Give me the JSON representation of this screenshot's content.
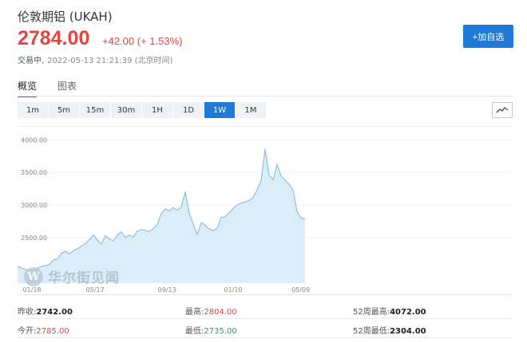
{
  "header": {
    "title": "伦敦期铝  (UKAH)",
    "price": "2784.00",
    "change": "+42.00  (+ 1.53%)",
    "status": "交易中,",
    "timestamp": "2022-05-13 21:21:39 (北京时间)",
    "add_button": "+加自选"
  },
  "tabs": [
    {
      "label": "概览"
    },
    {
      "label": "图表"
    }
  ],
  "periods": [
    "1m",
    "5m",
    "15m",
    "30m",
    "1H",
    "1D",
    "1W",
    "1M"
  ],
  "active_period": "1W",
  "colors": {
    "accent": "#1e7ad6",
    "up": "#e8433c",
    "down": "#23a36b",
    "line": "#8ebfe0",
    "fill": "#dcedfa"
  },
  "watermark": "华尔街见闻",
  "chart_data": {
    "type": "area",
    "y_ticks": [
      "4000.00",
      "3500.00",
      "3000.00",
      "2500.00"
    ],
    "x_ticks": [
      "01/18",
      "05/17",
      "09/13",
      "01/10",
      "05/09"
    ],
    "ylim": [
      1800,
      4200
    ],
    "values": [
      2060,
      2030,
      2010,
      1990,
      2000,
      2030,
      2060,
      2070,
      2090,
      2160,
      2170,
      2260,
      2290,
      2250,
      2300,
      2330,
      2370,
      2410,
      2470,
      2540,
      2460,
      2400,
      2530,
      2480,
      2450,
      2540,
      2590,
      2500,
      2540,
      2510,
      2600,
      2620,
      2610,
      2590,
      2640,
      2700,
      2870,
      2940,
      2910,
      2960,
      2920,
      2970,
      3200,
      2880,
      2710,
      2550,
      2730,
      2690,
      2630,
      2610,
      2640,
      2810,
      2820,
      2880,
      2950,
      3000,
      3030,
      3050,
      3070,
      3120,
      3230,
      3370,
      3860,
      3460,
      3390,
      3620,
      3450,
      3380,
      3320,
      3230,
      2900,
      2800,
      2784
    ]
  },
  "stats": [
    [
      {
        "label": "昨收:",
        "value": "2742.00",
        "tone": "plain"
      },
      {
        "label": "最高:",
        "value": "2804.00",
        "tone": "red"
      },
      {
        "label": "52周最高:",
        "value": "4072.00",
        "tone": "plain"
      }
    ],
    [
      {
        "label": "今开:",
        "value": "2785.00",
        "tone": "red"
      },
      {
        "label": "最低:",
        "value": "2735.00",
        "tone": "green"
      },
      {
        "label": "52周最低:",
        "value": "2304.00",
        "tone": "plain"
      }
    ]
  ]
}
